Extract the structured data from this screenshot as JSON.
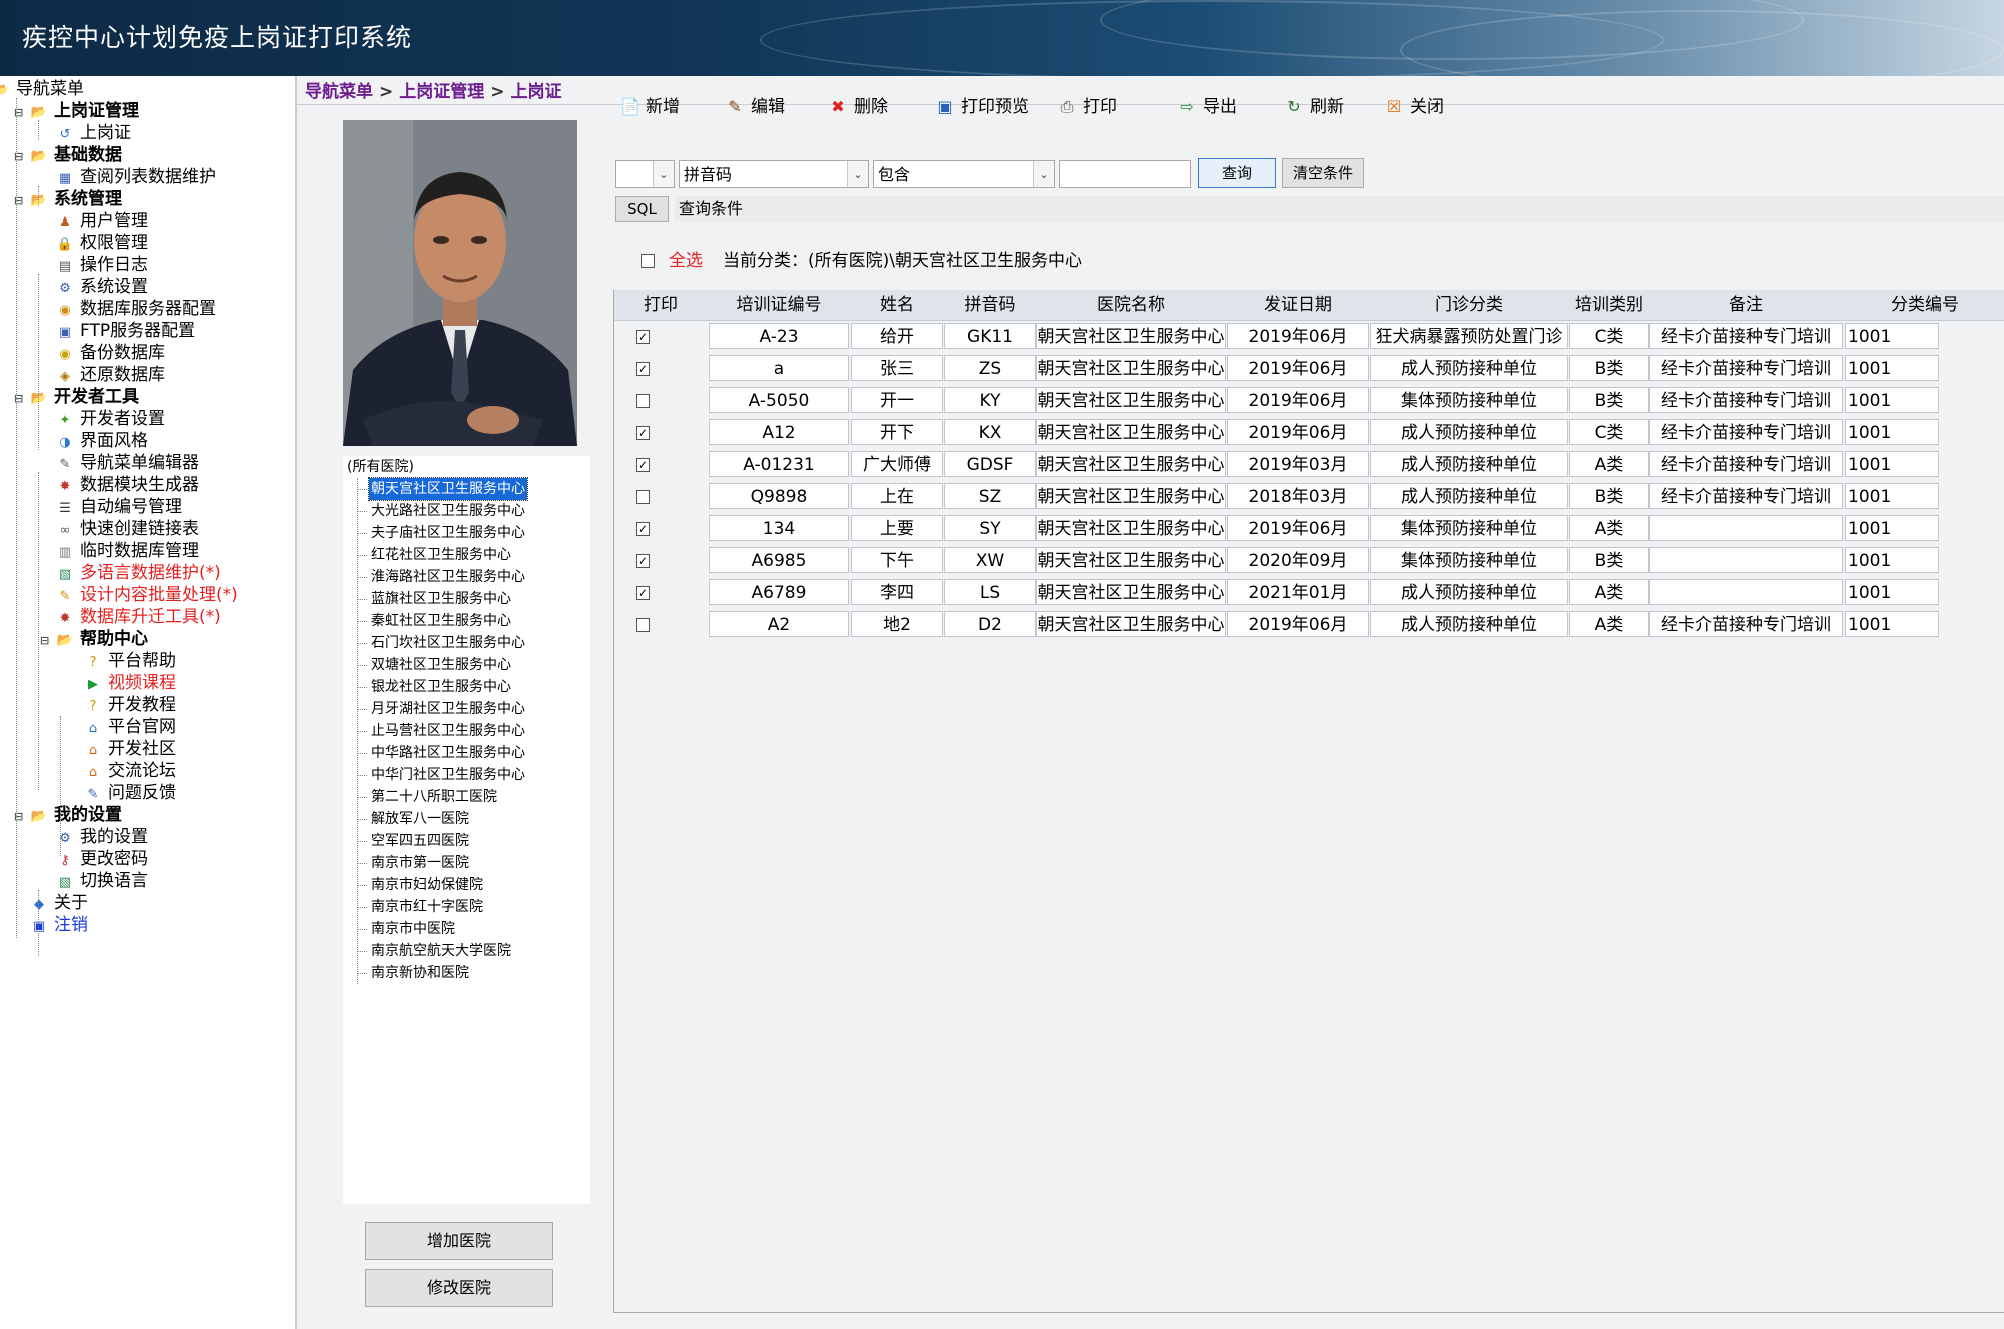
{
  "app": {
    "title": "疾控中心计划免疫上岗证打印系统"
  },
  "sidebar": {
    "items": [
      {
        "label": "导航菜单",
        "icon": "folder-open-icon"
      },
      {
        "label": "上岗证管理",
        "icon": "folder-open-icon"
      },
      {
        "label": "上岗证",
        "icon": "card-icon"
      },
      {
        "label": "基础数据",
        "icon": "folder-open-icon"
      },
      {
        "label": "查阅列表数据维护",
        "icon": "grid-icon"
      },
      {
        "label": "系统管理",
        "icon": "folder-open-icon"
      },
      {
        "label": "用户管理",
        "icon": "users-icon"
      },
      {
        "label": "权限管理",
        "icon": "lock-icon"
      },
      {
        "label": "操作日志",
        "icon": "log-icon"
      },
      {
        "label": "系统设置",
        "icon": "settings-icon"
      },
      {
        "label": "数据库服务器配置",
        "icon": "database-icon"
      },
      {
        "label": "FTP服务器配置",
        "icon": "ftp-icon"
      },
      {
        "label": "备份数据库",
        "icon": "database-backup-icon"
      },
      {
        "label": "还原数据库",
        "icon": "database-restore-icon"
      },
      {
        "label": "开发者工具",
        "icon": "folder-open-icon"
      },
      {
        "label": "开发者设置",
        "icon": "puzzle-icon"
      },
      {
        "label": "界面风格",
        "icon": "palette-icon"
      },
      {
        "label": "导航菜单编辑器",
        "icon": "edit-icon"
      },
      {
        "label": "数据模块生成器",
        "icon": "wand-icon"
      },
      {
        "label": "自动编号管理",
        "icon": "list-icon"
      },
      {
        "label": "快速创建链接表",
        "icon": "link-icon"
      },
      {
        "label": "临时数据库管理",
        "icon": "temp-db-icon"
      },
      {
        "label": "多语言数据维护(*)",
        "icon": "language-icon"
      },
      {
        "label": "设计内容批量处理(*)",
        "icon": "batch-icon"
      },
      {
        "label": "数据库升迁工具(*)",
        "icon": "migrate-icon"
      },
      {
        "label": "帮助中心",
        "icon": "folder-open-icon"
      },
      {
        "label": "平台帮助",
        "icon": "help-icon"
      },
      {
        "label": "视频课程",
        "icon": "video-icon"
      },
      {
        "label": "开发教程",
        "icon": "help-icon"
      },
      {
        "label": "平台官网",
        "icon": "home-icon"
      },
      {
        "label": "开发社区",
        "icon": "community-icon"
      },
      {
        "label": "交流论坛",
        "icon": "forum-icon"
      },
      {
        "label": "问题反馈",
        "icon": "feedback-icon"
      },
      {
        "label": "我的设置",
        "icon": "folder-open-icon"
      },
      {
        "label": "我的设置",
        "icon": "settings-icon"
      },
      {
        "label": "更改密码",
        "icon": "key-icon"
      },
      {
        "label": "切换语言",
        "icon": "language-icon"
      },
      {
        "label": "关于",
        "icon": "info-icon"
      },
      {
        "label": "注销",
        "icon": "logout-icon"
      }
    ]
  },
  "breadcrumb": [
    "导航菜单",
    "上岗证管理",
    "上岗证"
  ],
  "toolbar": [
    {
      "label": "新增",
      "icon": "add-icon"
    },
    {
      "label": "编辑",
      "icon": "edit-icon"
    },
    {
      "label": "删除",
      "icon": "delete-icon"
    },
    {
      "label": "打印预览",
      "icon": "print-preview-icon"
    },
    {
      "label": "打印",
      "icon": "printer-icon"
    },
    {
      "label": "导出",
      "icon": "export-icon"
    },
    {
      "label": "刷新",
      "icon": "refresh-icon"
    },
    {
      "label": "关闭",
      "icon": "close-icon"
    }
  ],
  "filter": {
    "logic_value": "",
    "field_value": "拼音码",
    "operator_value": "包含",
    "text_value": "",
    "query_label": "查询",
    "clear_label": "清空条件",
    "sql_label": "SQL",
    "sql_value": "查询条件"
  },
  "selection": {
    "select_all_label": "全选",
    "current_category": "当前分类：(所有医院)\\朝天宫社区卫生服务中心"
  },
  "hospital_tree": {
    "root": "(所有医院)",
    "selected_index": 0,
    "items": [
      "朝天宫社区卫生服务中心",
      "大光路社区卫生服务中心",
      "夫子庙社区卫生服务中心",
      "红花社区卫生服务中心",
      "淮海路社区卫生服务中心",
      "蓝旗社区卫生服务中心",
      "秦虹社区卫生服务中心",
      "石门坎社区卫生服务中心",
      "双塘社区卫生服务中心",
      "银龙社区卫生服务中心",
      "月牙湖社区卫生服务中心",
      "止马营社区卫生服务中心",
      "中华路社区卫生服务中心",
      "中华门社区卫生服务中心",
      "第二十八所职工医院",
      "解放军八一医院",
      "空军四五四医院",
      "南京市第一医院",
      "南京市妇幼保健院",
      "南京市红十字医院",
      "南京市中医院",
      "南京航空航天大学医院",
      "南京新协和医院"
    ],
    "add_label": "增加医院",
    "edit_label": "修改医院"
  },
  "table": {
    "headers": [
      "打印",
      "培训证编号",
      "姓名",
      "拼音码",
      "医院名称",
      "发证日期",
      "门诊分类",
      "培训类别",
      "备注",
      "分类编号"
    ],
    "rows": [
      {
        "checked": true,
        "cells": [
          "A-23",
          "给开",
          "GK11",
          "朝天宫社区卫生服务中心",
          "2019年06月",
          "狂犬病暴露预防处置门诊",
          "C类",
          "经卡介苗接种专门培训",
          "1001"
        ]
      },
      {
        "checked": true,
        "cells": [
          "a",
          "张三",
          "ZS",
          "朝天宫社区卫生服务中心",
          "2019年06月",
          "成人预防接种单位",
          "B类",
          "经卡介苗接种专门培训",
          "1001"
        ]
      },
      {
        "checked": false,
        "cells": [
          "A-5050",
          "开一",
          "KY",
          "朝天宫社区卫生服务中心",
          "2019年06月",
          "集体预防接种单位",
          "B类",
          "经卡介苗接种专门培训",
          "1001"
        ]
      },
      {
        "checked": true,
        "cells": [
          "A12",
          "开下",
          "KX",
          "朝天宫社区卫生服务中心",
          "2019年06月",
          "成人预防接种单位",
          "C类",
          "经卡介苗接种专门培训",
          "1001"
        ]
      },
      {
        "checked": true,
        "cells": [
          "A-01231",
          "广大师傅",
          "GDSF",
          "朝天宫社区卫生服务中心",
          "2019年03月",
          "成人预防接种单位",
          "A类",
          "经卡介苗接种专门培训",
          "1001"
        ]
      },
      {
        "checked": false,
        "cells": [
          "Q9898",
          "上在",
          "SZ",
          "朝天宫社区卫生服务中心",
          "2018年03月",
          "成人预防接种单位",
          "B类",
          "经卡介苗接种专门培训",
          "1001"
        ]
      },
      {
        "checked": true,
        "cells": [
          "134",
          "上要",
          "SY",
          "朝天宫社区卫生服务中心",
          "2019年06月",
          "集体预防接种单位",
          "A类",
          "",
          "1001"
        ]
      },
      {
        "checked": true,
        "cells": [
          "A6985",
          "下午",
          "XW",
          "朝天宫社区卫生服务中心",
          "2020年09月",
          "集体预防接种单位",
          "B类",
          "",
          "1001"
        ]
      },
      {
        "checked": true,
        "cells": [
          "A6789",
          "李四",
          "LS",
          "朝天宫社区卫生服务中心",
          "2021年01月",
          "成人预防接种单位",
          "A类",
          "",
          "1001"
        ]
      },
      {
        "checked": false,
        "cells": [
          "A2",
          "地2",
          "D2",
          "朝天宫社区卫生服务中心",
          "2019年06月",
          "成人预防接种单位",
          "A类",
          "经卡介苗接种专门培训",
          "1001"
        ]
      }
    ]
  },
  "colors": {
    "accent": "#1768d8",
    "breadcrumb": "#6c1f8e",
    "alert_red": "#e52020",
    "logout_blue": "#1b39d8"
  }
}
